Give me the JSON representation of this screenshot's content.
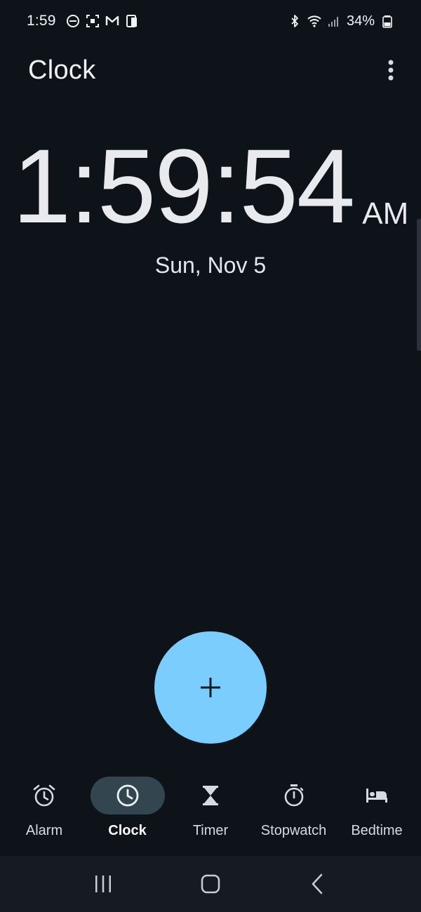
{
  "status_bar": {
    "time": "1:59",
    "battery_percent": "34%",
    "left_icons": [
      "dnd-icon",
      "screenshot-icon",
      "gmail-icon",
      "device-icon"
    ],
    "right_icons": [
      "bluetooth-icon",
      "wifi-icon",
      "signal-icon",
      "battery-icon"
    ]
  },
  "header": {
    "title": "Clock",
    "overflow_icon": "more-vert-icon"
  },
  "clock": {
    "time": "1:59:54",
    "ampm": "AM",
    "date": "Sun, Nov 5"
  },
  "fab": {
    "icon": "plus-icon",
    "color": "#7bcdfd"
  },
  "bottom_nav": {
    "items": [
      {
        "label": "Alarm",
        "icon": "alarm-icon",
        "active": false
      },
      {
        "label": "Clock",
        "icon": "clock-icon",
        "active": true
      },
      {
        "label": "Timer",
        "icon": "hourglass-icon",
        "active": false
      },
      {
        "label": "Stopwatch",
        "icon": "stopwatch-icon",
        "active": false
      },
      {
        "label": "Bedtime",
        "icon": "bed-icon",
        "active": false
      }
    ],
    "active_pill_color": "#334650"
  },
  "system_nav": {
    "buttons": [
      "recents-icon",
      "home-icon",
      "back-icon"
    ]
  },
  "colors": {
    "background": "#0e131a",
    "text": "#e6e9ee",
    "system_nav_bg": "#161b22"
  }
}
